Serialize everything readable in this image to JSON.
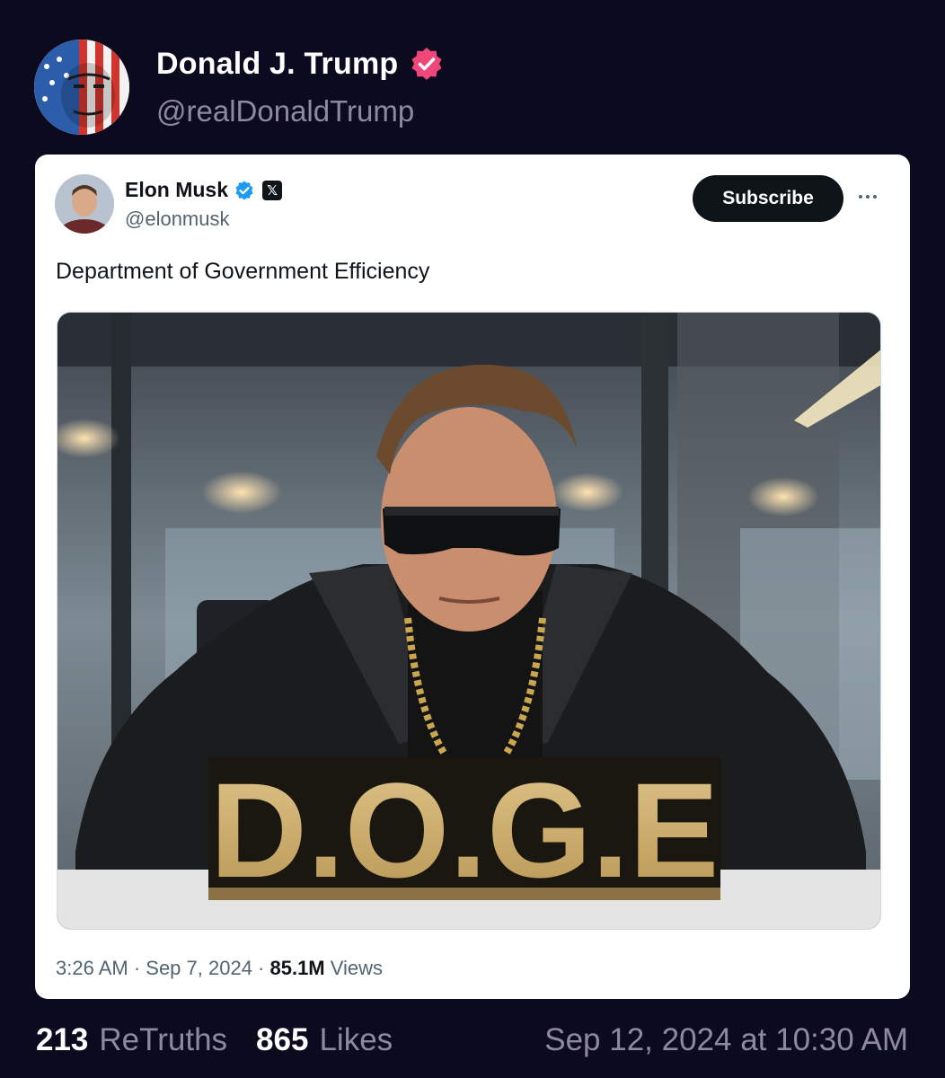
{
  "post": {
    "author_name": "Donald J. Trump",
    "author_handle": "@realDonaldTrump",
    "retruths_count": "213",
    "retruths_label": "ReTruths",
    "likes_count": "865",
    "likes_label": "Likes",
    "timestamp": "Sep 12, 2024 at 10:30 AM"
  },
  "embed": {
    "author_name": "Elon Musk",
    "author_handle": "@elonmusk",
    "x_badge": "𝕏",
    "subscribe_label": "Subscribe",
    "text": "Department of Government Efficiency",
    "image_sign_text": "D.O.G.E",
    "meta_time": "3:26 AM · Sep 7, 2024 · ",
    "meta_views_count": "85.1M",
    "meta_views_label": " Views"
  },
  "colors": {
    "page_background": "#0c0a1e",
    "verified_pink": "#f0477a",
    "verified_blue": "#1d9bf0",
    "secondary_text": "#8d8a9f"
  },
  "icons": {
    "post_verified": "verified-badge-icon",
    "embed_verified": "verified-check-icon",
    "embed_platform": "x-logo-icon",
    "embed_menu": "more-dots-icon"
  }
}
